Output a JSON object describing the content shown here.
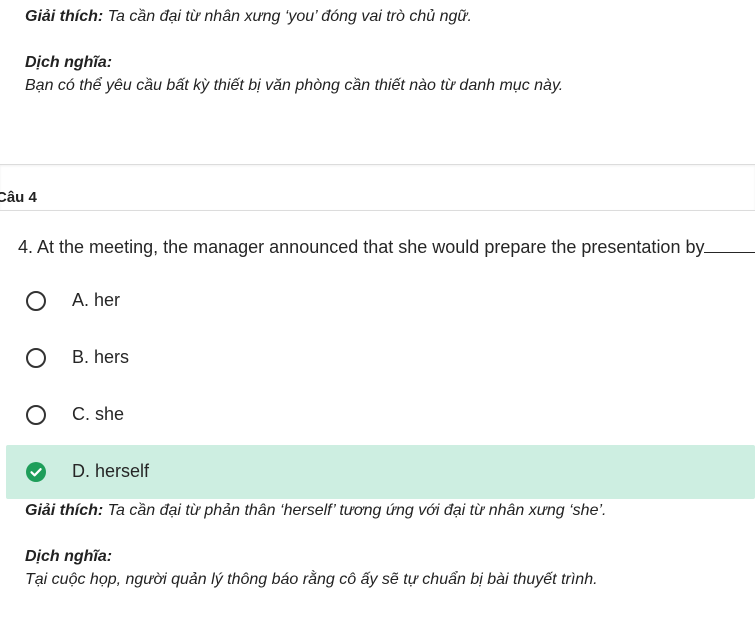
{
  "previous": {
    "explain_label": "Giải thích:",
    "explain_text": " Ta cần đại từ nhân xưng ‘you’ đóng vai trò chủ ngữ.",
    "translate_label": "Dịch nghĩa:",
    "translate_text": "Bạn có thể yêu cầu bất kỳ thiết bị văn phòng cần thiết nào từ danh mục này."
  },
  "question": {
    "number_label": "Câu 4",
    "text": "4. At the meeting, the manager announced that she would prepare the presentation by",
    "options": [
      {
        "label": "A. her",
        "selected": false
      },
      {
        "label": "B. hers",
        "selected": false
      },
      {
        "label": "C. she",
        "selected": false
      },
      {
        "label": "D. herself",
        "selected": true
      }
    ]
  },
  "explanation": {
    "explain_label": "Giải thích:",
    "explain_text": " Ta cần đại từ phản thân ‘herself’ tương ứng với đại từ nhân xưng ‘she’.",
    "translate_label": "Dịch nghĩa:",
    "translate_text": "Tại cuộc họp, người quản lý thông báo rằng cô ấy sẽ tự chuẩn bị bài thuyết trình."
  },
  "colors": {
    "selected_bg": "#cdeee1",
    "check_green": "#1e9e5a"
  },
  "icons": {
    "radio": "radio-empty-icon",
    "check": "check-circle-icon"
  }
}
